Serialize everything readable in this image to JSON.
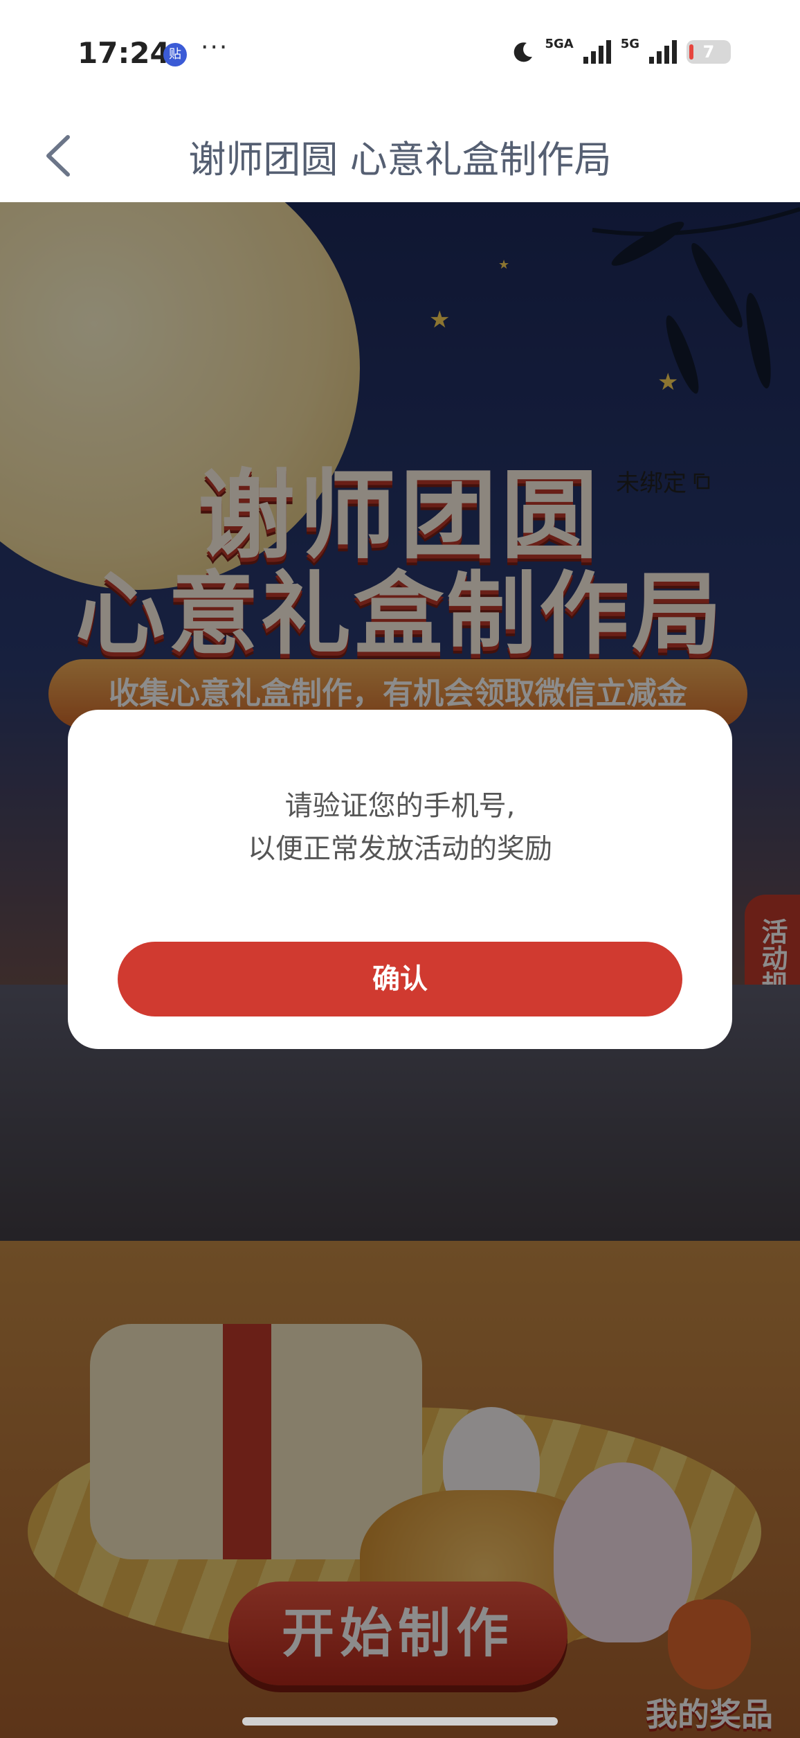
{
  "status_bar": {
    "time": "17:24",
    "app_badge": "贴",
    "more": "···",
    "network1": "5GA",
    "network2": "5G",
    "battery": "7"
  },
  "navbar": {
    "title": "谢师团圆 心意礼盒制作局"
  },
  "hero": {
    "title_line1": "谢师团圆",
    "title_line2": "心意礼盒制作局",
    "unbound_label": "未绑定",
    "ribbon_text": "收集心意礼盒制作，有机会领取微信立减金",
    "rules_label": "活动规则",
    "start_button": "开始制作",
    "my_prizes": "我的奖品"
  },
  "dialog": {
    "message_line1": "请验证您的手机号,",
    "message_line2": "以便正常发放活动的奖励",
    "confirm_label": "确认"
  }
}
